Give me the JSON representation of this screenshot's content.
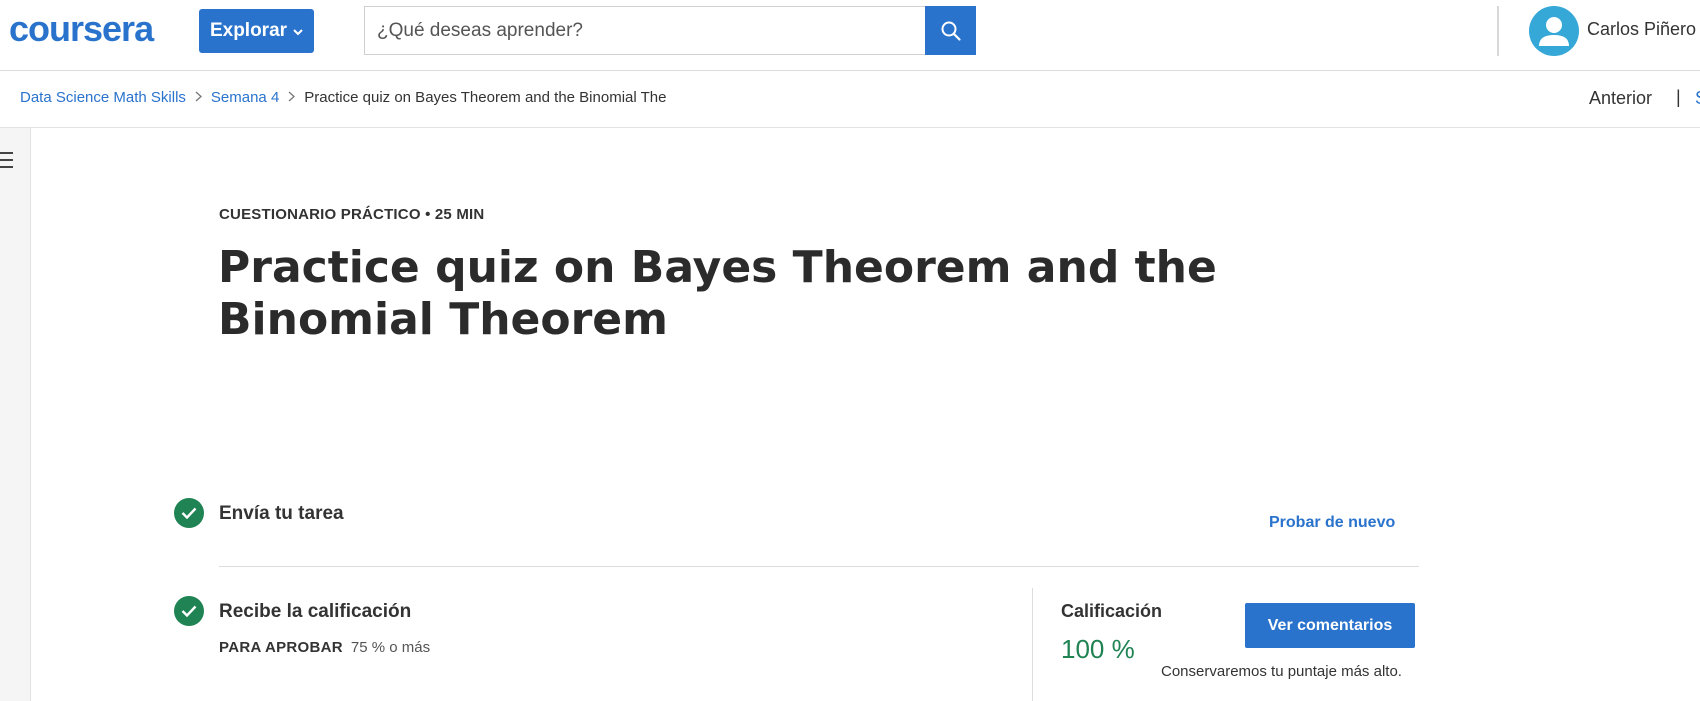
{
  "header": {
    "logo_text": "coursera",
    "explore_label": "Explorar",
    "search_placeholder": "¿Qué deseas aprender?",
    "user_name": "Carlos Piñero"
  },
  "breadcrumb": {
    "items": [
      "Data Science Math Skills",
      "Semana 4"
    ],
    "current": "Practice quiz on Bayes Theorem and the Binomial The"
  },
  "nav": {
    "prev_label": "Anterior",
    "separator": "|",
    "next_label_partial": "S"
  },
  "quiz": {
    "eyebrow": "CUESTIONARIO PRÁCTICO • 25 MIN",
    "title": "Practice quiz on Bayes Theorem and the Binomial Theorem",
    "step1_label": "Envía tu tarea",
    "retry_label": "Probar de nuevo",
    "step2_label": "Recibe la calificación",
    "pass_label": "PARA APROBAR",
    "pass_value": "75 % o más",
    "grade_label": "Calificación",
    "grade_value": "100 %",
    "feedback_button": "Ver comentarios",
    "keep_note": "Conservaremos tu puntaje más alto."
  },
  "colors": {
    "brand_blue": "#2a73cc",
    "success_green": "#1f8354",
    "avatar_blue": "#36a8d8"
  },
  "icons": [
    "search-icon",
    "chevron-down-icon",
    "user-avatar-icon",
    "menu-icon",
    "check-circle-icon",
    "breadcrumb-chevron-icon"
  ]
}
